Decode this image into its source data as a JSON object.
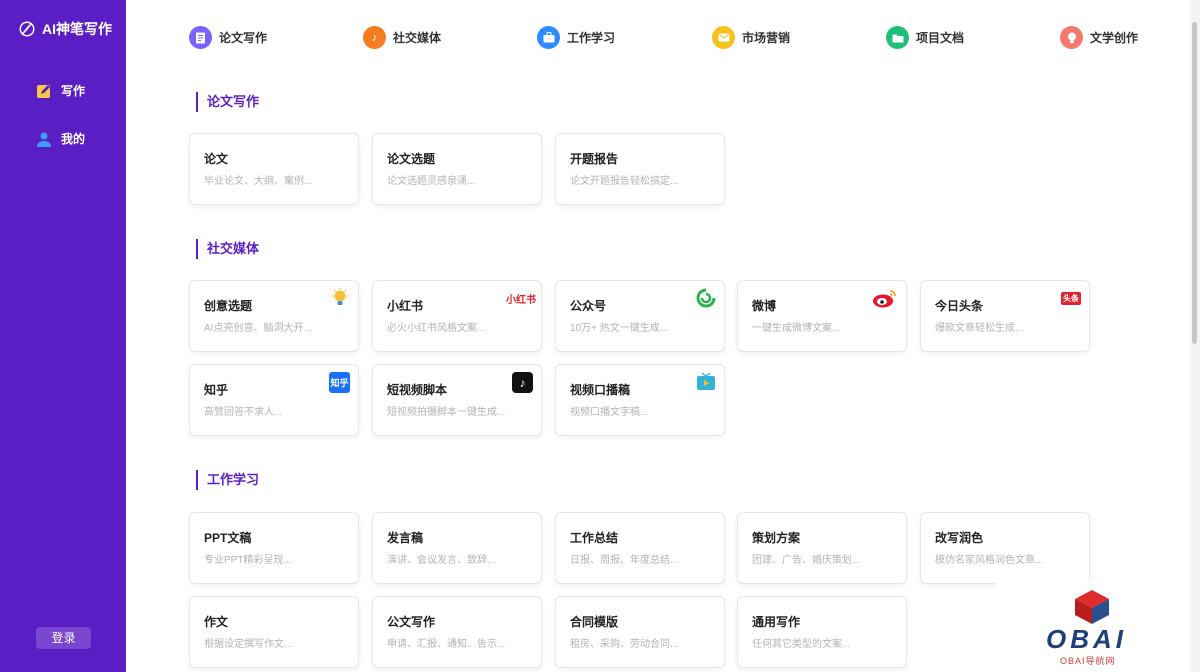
{
  "sidebar": {
    "brand": "AI神笔写作",
    "nav": [
      {
        "label": "写作",
        "icon": "pencil-note-icon"
      },
      {
        "label": "我的",
        "icon": "user-icon"
      }
    ],
    "login_label": "登录"
  },
  "topnav": [
    {
      "label": "论文写作",
      "icon": "document-icon",
      "color": "#7b61ff"
    },
    {
      "label": "社交媒体",
      "icon": "tiktok-icon",
      "color": "#f57c1f"
    },
    {
      "label": "工作学习",
      "icon": "briefcase-icon",
      "color": "#2e8bff"
    },
    {
      "label": "市场营销",
      "icon": "mail-icon",
      "color": "#f6c21b"
    },
    {
      "label": "项目文档",
      "icon": "folder-icon",
      "color": "#1fbf7a"
    },
    {
      "label": "文学创作",
      "icon": "bulb-icon",
      "color": "#f47a6d"
    }
  ],
  "sections": [
    {
      "title": "论文写作",
      "cards": [
        {
          "title": "论文",
          "desc": "毕业论文、大纲、案例..."
        },
        {
          "title": "论文选题",
          "desc": "论文选题灵感泉涌..."
        },
        {
          "title": "开题报告",
          "desc": "论文开题报告轻松搞定..."
        }
      ]
    },
    {
      "title": "社交媒体",
      "cards": [
        {
          "title": "创意选题",
          "desc": "AI点亮创意、脑洞大开...",
          "icon": "lightbulb-icon",
          "badge": "💡"
        },
        {
          "title": "小红书",
          "desc": "必火小红书风格文案...",
          "icon": "xiaohongshu-logo-icon",
          "badge": "小红书"
        },
        {
          "title": "公众号",
          "desc": "10万+ 热文一键生成...",
          "icon": "wechat-official-logo-icon",
          "badge": "◎"
        },
        {
          "title": "微博",
          "desc": "一键生成微博文案...",
          "icon": "weibo-logo-icon",
          "badge": "◉"
        },
        {
          "title": "今日头条",
          "desc": "爆款文章轻松生成...",
          "icon": "toutiao-logo-icon",
          "badge": "头条"
        },
        {
          "title": "知乎",
          "desc": "高赞回答不求人...",
          "icon": "zhihu-logo-icon",
          "badge": "知乎"
        },
        {
          "title": "短视频脚本",
          "desc": "短视频拍摄脚本一键生成...",
          "icon": "tiktok-logo-icon",
          "badge": "♪"
        },
        {
          "title": "视频口播稿",
          "desc": "视频口播文字稿...",
          "icon": "tv-icon",
          "badge": "▶"
        }
      ]
    },
    {
      "title": "工作学习",
      "cards": [
        {
          "title": "PPT文稿",
          "desc": "专业PPT精彩呈现..."
        },
        {
          "title": "发言稿",
          "desc": "演讲、会议发言、致辞..."
        },
        {
          "title": "工作总结",
          "desc": "日报、周报、年度总结..."
        },
        {
          "title": "策划方案",
          "desc": "团建、广告、婚庆策划..."
        },
        {
          "title": "改写润色",
          "desc": "模仿名家风格润色文章..."
        },
        {
          "title": "作文",
          "desc": "根据设定撰写作文..."
        },
        {
          "title": "公文写作",
          "desc": "申请、汇报、通知、告示..."
        },
        {
          "title": "合同模版",
          "desc": "租房、采购、劳动合同..."
        },
        {
          "title": "通用写作",
          "desc": "任何其它类型的文案..."
        }
      ]
    }
  ],
  "watermark": {
    "text": "OBAI",
    "sub": "OBAI导航网"
  }
}
